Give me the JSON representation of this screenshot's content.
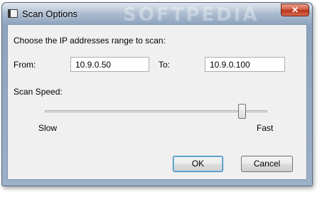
{
  "window": {
    "title": "Scan Options",
    "watermark": "SOFTPEDIA",
    "close_glyph": "✕"
  },
  "form": {
    "prompt": "Choose the IP addresses range to scan:",
    "from_label": "From:",
    "from_value": "10.9.0.50",
    "to_label": "To:",
    "to_value": "10.9.0.100",
    "speed_label": "Scan Speed:",
    "slow_label": "Slow",
    "fast_label": "Fast",
    "speed_level": 0.9
  },
  "buttons": {
    "ok": "OK",
    "cancel": "Cancel"
  }
}
